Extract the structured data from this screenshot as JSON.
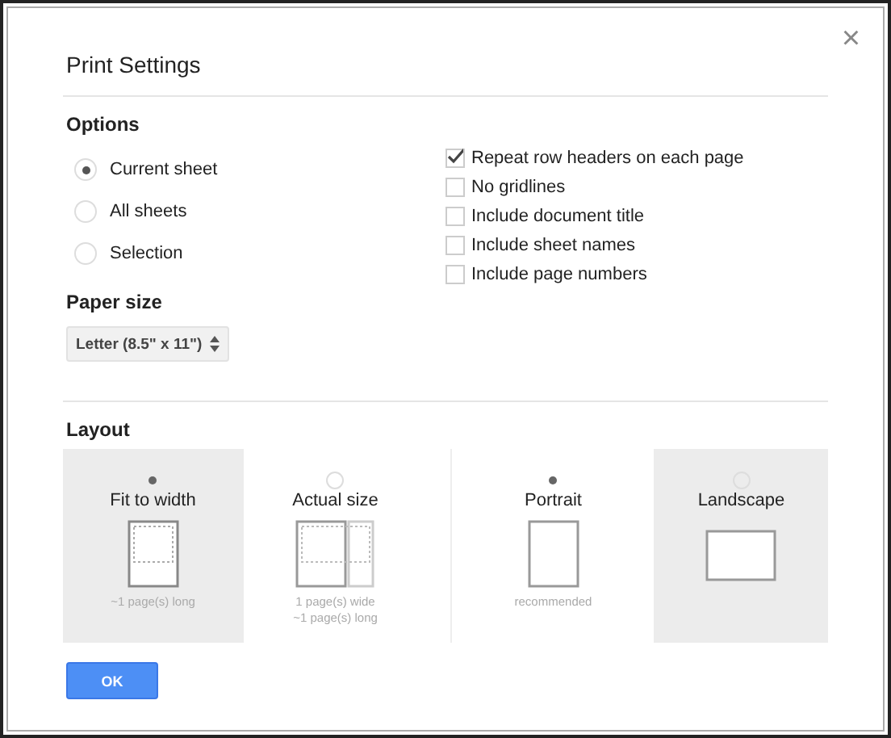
{
  "dialog": {
    "title": "Print Settings",
    "close": "×"
  },
  "options": {
    "heading": "Options",
    "scope": [
      {
        "label": "Current sheet",
        "selected": true
      },
      {
        "label": "All sheets",
        "selected": false
      },
      {
        "label": "Selection",
        "selected": false
      }
    ],
    "checks": [
      {
        "label": "Repeat row headers on each page",
        "checked": true
      },
      {
        "label": "No gridlines",
        "checked": false
      },
      {
        "label": "Include document title",
        "checked": false
      },
      {
        "label": "Include sheet names",
        "checked": false
      },
      {
        "label": "Include page numbers",
        "checked": false
      }
    ]
  },
  "paper_size": {
    "heading": "Paper size",
    "value": "Letter (8.5\" x 11\")"
  },
  "layout": {
    "heading": "Layout",
    "scale": [
      {
        "kind": "fit",
        "label": "Fit to width",
        "selected": true,
        "shaded": true,
        "notes": [
          "~1 page(s) long"
        ]
      },
      {
        "kind": "actual",
        "label": "Actual size",
        "selected": false,
        "shaded": false,
        "notes": [
          "1 page(s) wide",
          "~1 page(s) long"
        ]
      }
    ],
    "orientation": [
      {
        "kind": "portrait",
        "label": "Portrait",
        "selected": true,
        "shaded": false,
        "notes": [
          "recommended"
        ]
      },
      {
        "kind": "landscape",
        "label": "Landscape",
        "selected": false,
        "shaded": true
      }
    ]
  },
  "buttons": [
    {
      "label": "OK"
    }
  ]
}
